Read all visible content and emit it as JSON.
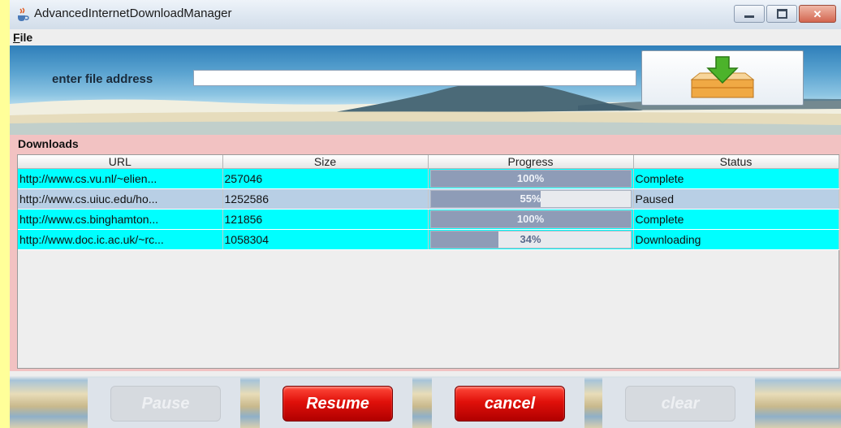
{
  "window": {
    "title": "AdvancedInternetDownloadManager"
  },
  "menu": {
    "file": "File"
  },
  "address": {
    "label": "enter file address",
    "value": ""
  },
  "downloads": {
    "title": "Downloads",
    "columns": [
      "URL",
      "Size",
      "Progress",
      "Status"
    ],
    "rows": [
      {
        "url": "http://www.cs.vu.nl/~elien...",
        "size": "257046",
        "progress": 100,
        "progress_label": "100%",
        "status": "Complete",
        "selected": true
      },
      {
        "url": "http://www.cs.uiuc.edu/ho...",
        "size": "1252586",
        "progress": 55,
        "progress_label": "55%",
        "status": "Paused",
        "selected": false
      },
      {
        "url": "http://www.cs.binghamton...",
        "size": "121856",
        "progress": 100,
        "progress_label": "100%",
        "status": "Complete",
        "selected": true
      },
      {
        "url": "http://www.doc.ic.ac.uk/~rc...",
        "size": "1058304",
        "progress": 34,
        "progress_label": "34%",
        "status": "Downloading",
        "selected": true
      }
    ]
  },
  "buttons": {
    "pause": "Pause",
    "resume": "Resume",
    "cancel": "cancel",
    "clear": "clear"
  },
  "colors": {
    "selected_row": "#00ffff",
    "unselected_row": "#b8cfe5",
    "progress_fill": "#8e9cb7",
    "panel": "#f2c2c2",
    "action_red": "#e0100a"
  },
  "icons": {
    "app": "java-cup-icon",
    "download": "download-tray-icon"
  }
}
